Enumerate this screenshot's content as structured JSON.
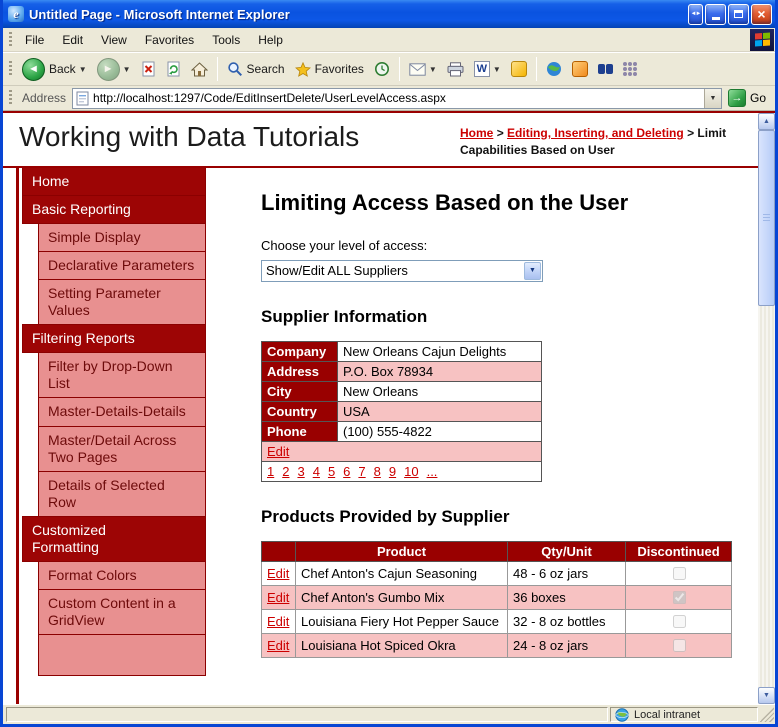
{
  "window": {
    "title": "Untitled Page - Microsoft Internet Explorer",
    "status_text": "Local intranet"
  },
  "menubar": {
    "items": [
      "File",
      "Edit",
      "View",
      "Favorites",
      "Tools",
      "Help"
    ]
  },
  "toolbar": {
    "back": "Back",
    "search": "Search",
    "favorites": "Favorites"
  },
  "addressbar": {
    "label": "Address",
    "url": "http://localhost:1297/Code/EditInsertDelete/UserLevelAccess.aspx",
    "go": "Go"
  },
  "icons": {
    "back": "green-circle-left-arrow",
    "forward": "green-circle-right-arrow",
    "stop": "page-with-red-x",
    "refresh": "page-with-green-arrows",
    "home": "house",
    "search": "magnifier",
    "favorites": "gold-star",
    "history": "clock",
    "mail": "envelope",
    "print": "printer",
    "edit": "word-w",
    "go": "green-square-arrow",
    "status_zone": "globe"
  },
  "masthead": {
    "title": "Working with Data Tutorials",
    "breadcrumb": {
      "home": "Home",
      "separator": ">",
      "section": "Editing, Inserting, and Deleting",
      "page": "Limit Capabilities Based on User"
    }
  },
  "sidebar": {
    "items": [
      {
        "label": "Home",
        "type": "section"
      },
      {
        "label": "Basic Reporting",
        "type": "section"
      },
      {
        "label": "Simple Display",
        "type": "sub"
      },
      {
        "label": "Declarative Parameters",
        "type": "sub"
      },
      {
        "label": "Setting Parameter Values",
        "type": "sub"
      },
      {
        "label": "Filtering Reports",
        "type": "section"
      },
      {
        "label": "Filter by Drop-Down List",
        "type": "sub"
      },
      {
        "label": "Master-Details-Details",
        "type": "sub"
      },
      {
        "label": "Master/Detail Across Two Pages",
        "type": "sub"
      },
      {
        "label": "Details of Selected Row",
        "type": "sub"
      },
      {
        "label": "Customized Formatting",
        "type": "section"
      },
      {
        "label": "Format Colors",
        "type": "sub"
      },
      {
        "label": "Custom Content in a GridView",
        "type": "sub"
      },
      {
        "label": "",
        "type": "sub"
      }
    ]
  },
  "main": {
    "heading": "Limiting Access Based on the User",
    "access_label": "Choose your level of access:",
    "access_selected": "Show/Edit ALL Suppliers",
    "supplier": {
      "heading": "Supplier Information",
      "fields": [
        {
          "label": "Company",
          "value": "New Orleans Cajun Delights"
        },
        {
          "label": "Address",
          "value": "P.O. Box 78934"
        },
        {
          "label": "City",
          "value": "New Orleans"
        },
        {
          "label": "Country",
          "value": "USA"
        },
        {
          "label": "Phone",
          "value": "(100) 555-4822"
        }
      ],
      "edit": "Edit",
      "pager": [
        "1",
        "2",
        "3",
        "4",
        "5",
        "6",
        "7",
        "8",
        "9",
        "10",
        "..."
      ]
    },
    "products": {
      "heading": "Products Provided by Supplier",
      "columns": {
        "edit": "",
        "product": "Product",
        "qty": "Qty/Unit",
        "discontinued": "Discontinued"
      },
      "rows": [
        {
          "edit": "Edit",
          "product": "Chef Anton's Cajun Seasoning",
          "qty": "48 - 6 oz jars",
          "discontinued": false
        },
        {
          "edit": "Edit",
          "product": "Chef Anton's Gumbo Mix",
          "qty": "36 boxes",
          "discontinued": true
        },
        {
          "edit": "Edit",
          "product": "Louisiana Fiery Hot Pepper Sauce",
          "qty": "32 - 8 oz bottles",
          "discontinued": false
        },
        {
          "edit": "Edit",
          "product": "Louisiana Hot Spiced Okra",
          "qty": "24 - 8 oz jars",
          "discontinued": false
        }
      ]
    }
  },
  "colors": {
    "brand_maroon": "#990000",
    "sidebar_pink": "#e89090",
    "row_pink": "#f7c2c2",
    "link_red": "#cc0000",
    "titlebar_blue": "#0a53e0",
    "chrome_beige": "#ece9d8"
  }
}
